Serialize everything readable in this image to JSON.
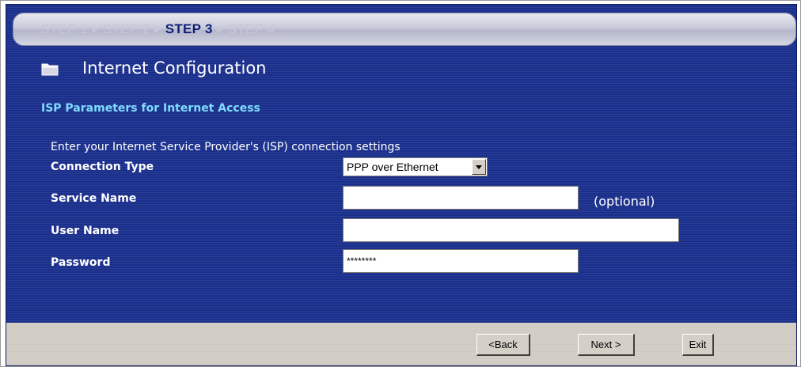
{
  "wizard": {
    "steps": [
      {
        "label": "STEP 1",
        "active": false
      },
      {
        "label": "STEP 2",
        "active": false
      },
      {
        "label": "STEP 3",
        "active": true
      },
      {
        "label": "STEP 4",
        "active": false
      }
    ],
    "step_separator": "▶"
  },
  "page": {
    "title": "Internet Configuration",
    "section_title": "ISP Parameters for Internet Access",
    "intro": "Enter your Internet Service Provider's (ISP) connection settings"
  },
  "form": {
    "connection_type": {
      "label": "Connection Type",
      "value": "PPP over Ethernet"
    },
    "service_name": {
      "label": "Service Name",
      "value": "",
      "hint": "(optional)"
    },
    "user_name": {
      "label": "User Name",
      "value": ""
    },
    "password": {
      "label": "Password",
      "value": "********"
    }
  },
  "buttons": {
    "back": "<Back",
    "next": "Next >",
    "exit": "Exit"
  },
  "colors": {
    "panel_background": "#1a2f8c",
    "section_title": "#7fdcff",
    "active_step": "#0e1e78",
    "footer": "#d4d0c8"
  },
  "icons": {
    "title_icon": "folder-icon"
  }
}
